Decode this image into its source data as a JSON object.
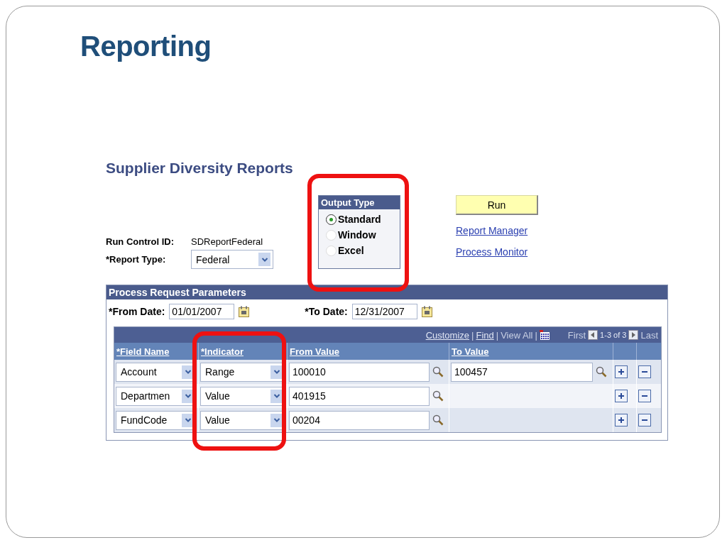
{
  "slide": {
    "title": "Reporting"
  },
  "page": {
    "title": "Supplier Diversity Reports",
    "run_control": {
      "label": "Run Control ID:",
      "value": "SDReportFederal"
    },
    "report_type": {
      "label": "*Report Type:",
      "value": "Federal"
    },
    "output_type": {
      "title": "Output Type",
      "options": [
        {
          "label": "Standard",
          "selected": true
        },
        {
          "label": "Window",
          "selected": false
        },
        {
          "label": "Excel",
          "selected": false
        }
      ]
    },
    "run_button": "Run",
    "links": [
      "Report Manager",
      "Process Monitor"
    ],
    "parameters": {
      "title": "Process Request Parameters",
      "from_date": {
        "label": "*From Date:",
        "value": "01/01/2007"
      },
      "to_date": {
        "label": "*To Date:",
        "value": "12/31/2007"
      },
      "grid": {
        "nav": [
          {
            "kind": "link",
            "text": "Customize"
          },
          {
            "kind": "sep",
            "text": "|"
          },
          {
            "kind": "link",
            "text": "Find"
          },
          {
            "kind": "sep",
            "text": "|"
          },
          {
            "kind": "plain",
            "text": "View All"
          },
          {
            "kind": "sep",
            "text": "|"
          },
          {
            "kind": "grid-icon"
          },
          {
            "kind": "plain",
            "text": "First"
          },
          {
            "kind": "prev"
          },
          {
            "kind": "count",
            "text": "1-3 of 3"
          },
          {
            "kind": "next"
          },
          {
            "kind": "plain",
            "text": "Last"
          }
        ],
        "columns": [
          "*Field Name",
          "*Indicator",
          "From Value",
          "To Value"
        ],
        "rows": [
          {
            "field_name": "Account",
            "indicator": "Range",
            "from_value": "100010",
            "to_value": "100457"
          },
          {
            "field_name": "Departmen",
            "indicator": "Value",
            "from_value": "401915"
          },
          {
            "field_name": "FundCode",
            "indicator": "Value",
            "from_value": "00204"
          }
        ]
      }
    }
  }
}
